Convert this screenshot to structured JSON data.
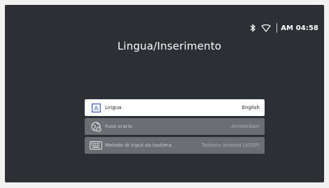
{
  "status_bar": {
    "bluetooth_icon": "bluetooth-icon",
    "wifi_icon": "wifi-icon",
    "time": "AM 04:58"
  },
  "page": {
    "title": "Lingua/Inserimento"
  },
  "settings": [
    {
      "icon": "language-icon",
      "label": "Lingua",
      "value": "English",
      "state": "selected"
    },
    {
      "icon": "timezone-globe-icon",
      "label": "Fuso orario",
      "value": "Amsterdam",
      "state": "normal"
    },
    {
      "icon": "keyboard-icon",
      "label": "Metodo di input da tastiera",
      "value": "Tastiera Android (AOSP)",
      "state": "normal"
    }
  ],
  "colors": {
    "background": "#2c2f34",
    "selected_row": "#ffffff",
    "row": "#6b6e73"
  }
}
